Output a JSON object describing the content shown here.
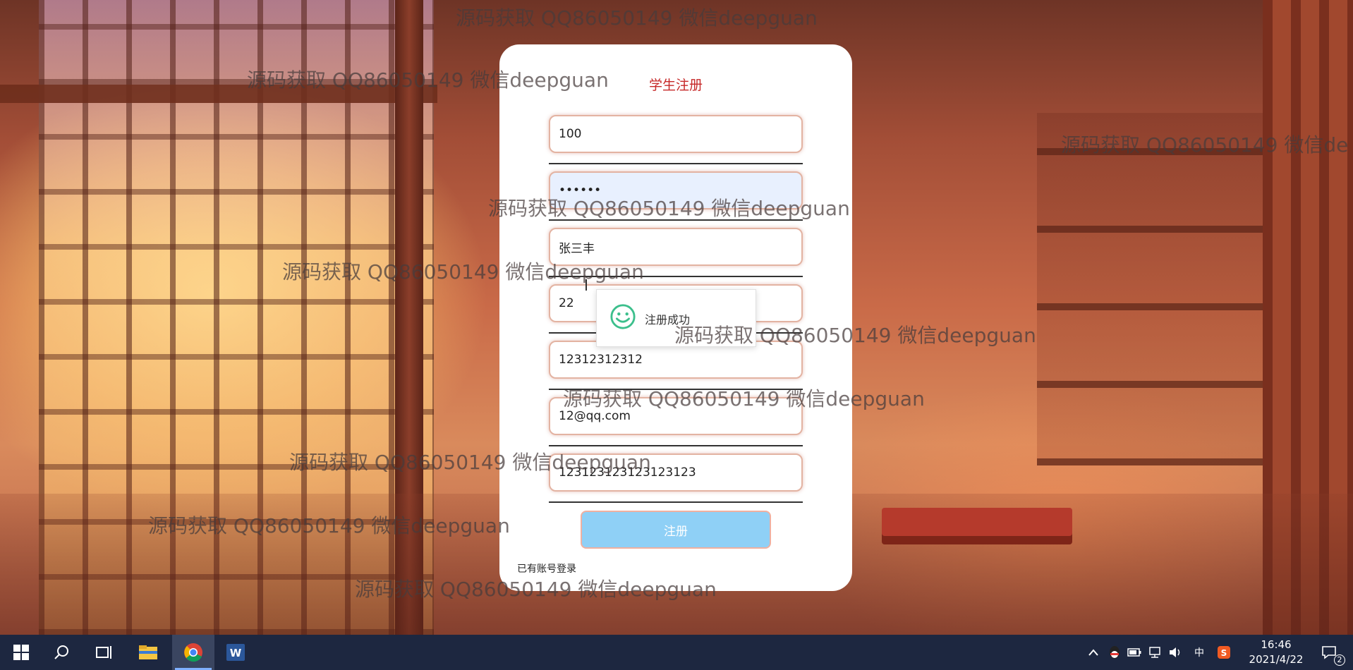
{
  "form": {
    "title": "学生注册",
    "fields": [
      {
        "value": "100"
      },
      {
        "value": "••••••"
      },
      {
        "value": "张三丰"
      },
      {
        "value": "22"
      },
      {
        "value": "12312312312"
      },
      {
        "value": "12@qq.com"
      },
      {
        "value": "123123123123123123"
      }
    ],
    "submit_label": "注册",
    "login_link": "已有账号登录"
  },
  "toast": {
    "message": "注册成功",
    "icon": "smiley-icon",
    "color": "#3cbf8c"
  },
  "watermarks": [
    "源码获取 QQ86050149 微信deepguan",
    "源码获取 QQ86050149 微信deepguan",
    "源码获取 QQ86050149 微信de",
    "源码获取 QQ86050149 微信deepguan",
    "源码获取 QQ86050149 微信deepguan",
    "源码获取 QQ86050149 微信deepguan",
    "源码获取 QQ86050149 微信deepguan",
    "源码获取 QQ86050149 微信deepguan",
    "源码获取 QQ86050149 微信deepguan",
    "源码获取 QQ86050149 微信deepguan"
  ],
  "taskbar": {
    "apps": [
      "start-icon",
      "search-icon",
      "task-view-icon",
      "file-explorer-icon",
      "chrome-icon",
      "word-icon"
    ],
    "tray_lang": "中",
    "time": "16:46",
    "date": "2021/4/22",
    "notification_count": "2"
  },
  "colors": {
    "title": "#c62828",
    "submit_bg": "#8fd0f6",
    "taskbar_bg": "#1d2740"
  }
}
